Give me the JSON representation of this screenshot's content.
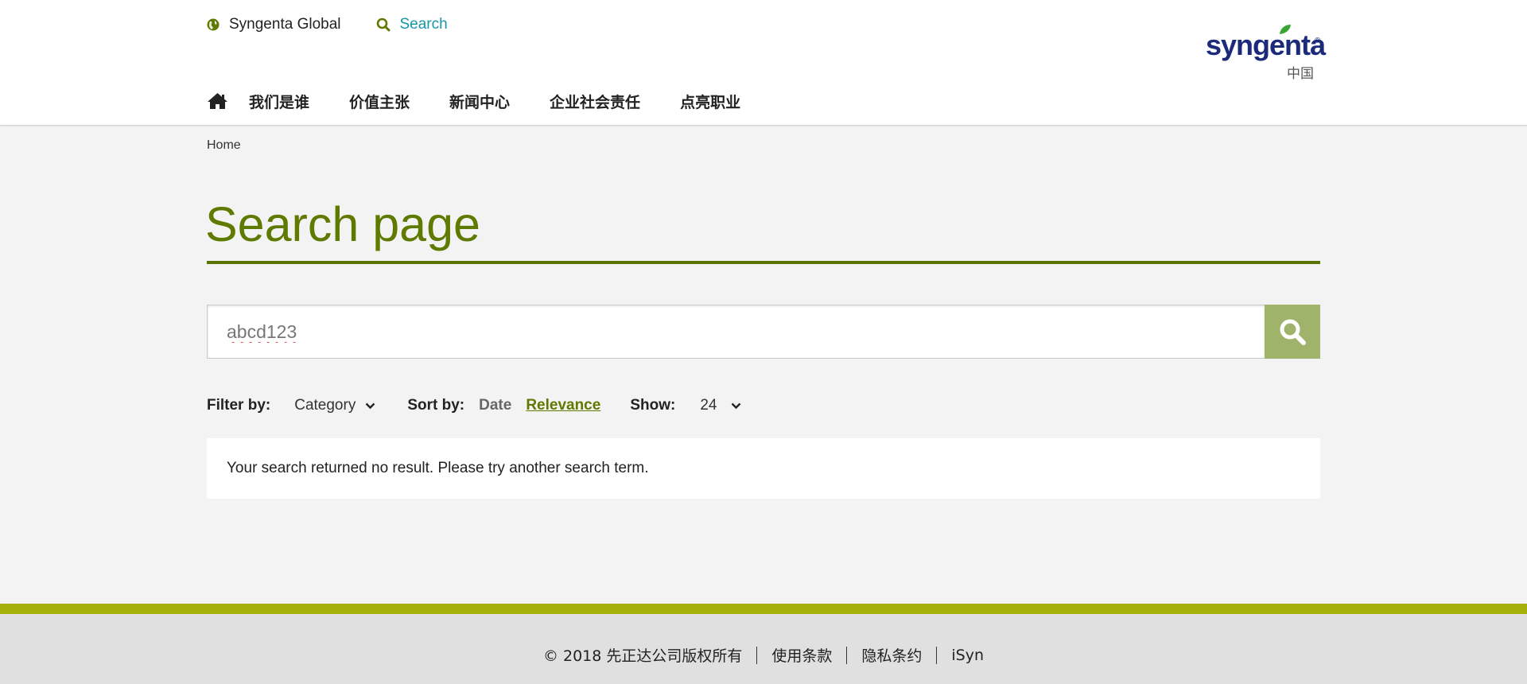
{
  "header": {
    "util": {
      "global_label": "Syngenta Global",
      "search_label": "Search"
    },
    "logo": {
      "wordmark": "syngenta",
      "registered": "®",
      "sub": "中国"
    },
    "nav": {
      "home_icon": "home-icon",
      "items": [
        {
          "label": "我们是谁"
        },
        {
          "label": "价值主张"
        },
        {
          "label": "新闻中心"
        },
        {
          "label": "企业社会责任"
        },
        {
          "label": "点亮职业"
        }
      ]
    }
  },
  "breadcrumb": {
    "home": "Home"
  },
  "page": {
    "title": "Search page"
  },
  "search": {
    "value": "abcd123",
    "button_icon": "search-icon"
  },
  "filters": {
    "filter_label": "Filter by:",
    "category": "Category",
    "sort_label": "Sort by:",
    "sort_date": "Date",
    "sort_relevance": "Relevance",
    "sort_selected": "Relevance",
    "show_label": "Show:",
    "show_value": "24"
  },
  "results": {
    "message": "Your search returned no result. Please try another search term."
  },
  "footer": {
    "copyright": "© 2018 先正达公司版权所有",
    "terms": "使用条款",
    "privacy": "隐私条约",
    "isyn": "iSyn"
  },
  "colors": {
    "brand_green": "#5f7a00",
    "search_teal": "#1597a7",
    "search_button": "#a0b36a",
    "footer_accent": "#a5b10a",
    "logo_blue": "#1b2a7a"
  }
}
